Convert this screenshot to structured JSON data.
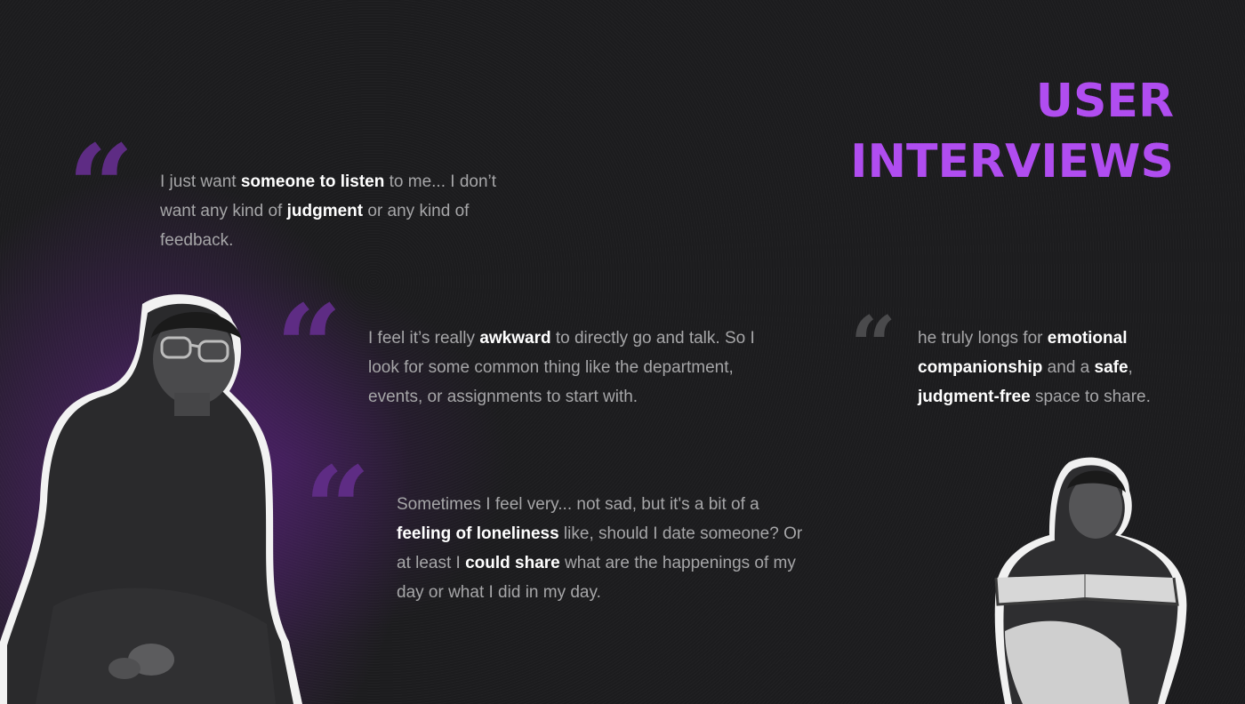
{
  "title": {
    "line1": "USER",
    "line2": "INTERVIEWS"
  },
  "quote_mark_glyph": "“",
  "quotes": [
    {
      "segments": [
        {
          "text": "I just want ",
          "bold": false
        },
        {
          "text": "someone to listen",
          "bold": true
        },
        {
          "text": " to me... I don’t want any kind of ",
          "bold": false
        },
        {
          "text": "judgment",
          "bold": true
        },
        {
          "text": " or any kind of feedback.",
          "bold": false
        }
      ]
    },
    {
      "segments": [
        {
          "text": "I feel it’s really ",
          "bold": false
        },
        {
          "text": "awkward",
          "bold": true
        },
        {
          "text": " to directly go and talk. So I look for some common thing like the department, events, or assignments to start with.",
          "bold": false
        }
      ]
    },
    {
      "segments": [
        {
          "text": "Sometimes I feel very... not sad, but it's a bit of a ",
          "bold": false
        },
        {
          "text": "feeling of loneliness",
          "bold": true
        },
        {
          "text": " like, should I date someone? Or at least I ",
          "bold": false
        },
        {
          "text": "could share",
          "bold": true
        },
        {
          "text": " what are the happenings of my day or what I did in my day.",
          "bold": false
        }
      ]
    },
    {
      "segments": [
        {
          "text": "he truly longs for ",
          "bold": false
        },
        {
          "text": "emotional companionship",
          "bold": true
        },
        {
          "text": " and a ",
          "bold": false
        },
        {
          "text": "safe",
          "bold": true
        },
        {
          "text": ", ",
          "bold": false
        },
        {
          "text": "judgment-free",
          "bold": true
        },
        {
          "text": " space to share.",
          "bold": false
        }
      ]
    }
  ],
  "colors": {
    "accent": "#b04df0",
    "quote_mark": "#5a2a7c",
    "quote_mark_gray": "#4a4a4c",
    "text_muted": "#a6a6a8",
    "text_bold": "#ffffff"
  }
}
